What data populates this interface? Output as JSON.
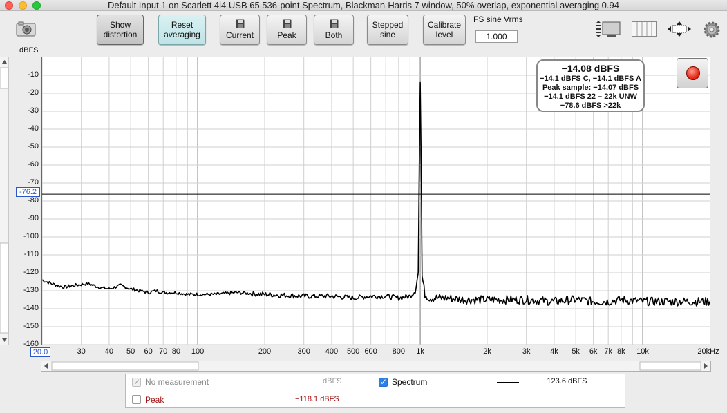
{
  "window": {
    "title": "Default Input 1 on Scarlett 4i4 USB 65,536-point Spectrum, Blackman-Harris 7 window, 50% overlap, exponential averaging 0.94"
  },
  "toolbar": {
    "show_distortion": [
      "Show",
      "distortion"
    ],
    "reset_averaging": [
      "Reset",
      "averaging"
    ],
    "current": "Current",
    "peak": "Peak",
    "both": "Both",
    "stepped_sine": [
      "Stepped",
      "sine"
    ],
    "calibrate_level": [
      "Calibrate",
      "level"
    ],
    "fs_label": "FS sine Vrms",
    "fs_value": "1.000"
  },
  "icons": {
    "camera": "camera-icon",
    "layout": "layout-icon",
    "columns": "columns-icon",
    "resize": "resize-arrows-icon",
    "gear": "gear-icon",
    "floppy": "floppy-disk-icon"
  },
  "info": {
    "line1": "−14.08 dBFS",
    "line2": "−14.1 dBFS C, −14.1 dBFS A",
    "line3": "Peak sample: −14.07 dBFS",
    "line4": "−14.1 dBFS 22 – 22k UNW",
    "line5": "−78.6 dBFS >22k"
  },
  "cursor": {
    "y_value": "-76.2",
    "x_start": "20.0"
  },
  "legend": {
    "no_measurement": "No measurement",
    "no_measurement_unit": "dBFS",
    "spectrum": "Spectrum",
    "spectrum_value": "−123.6 dBFS",
    "peak": "Peak",
    "peak_value": "−118.1 dBFS"
  },
  "colors": {
    "peak_text": "#a01818",
    "cursor_blue": "#2a56c8",
    "trace": "#000000",
    "record": "#e52c1b"
  },
  "chart_data": {
    "type": "line",
    "ylabel": "dBFS",
    "xlabel_unit": "kHz",
    "x_scale": "log",
    "xlim": [
      20,
      20000
    ],
    "ylim": [
      -160,
      0
    ],
    "y_ticks": [
      -10,
      -20,
      -30,
      -40,
      -50,
      -60,
      -70,
      -80,
      -90,
      -100,
      -110,
      -120,
      -130,
      -140,
      -150,
      -160
    ],
    "y_tick_labels": [
      "-10",
      "-20",
      "-30",
      "-40",
      "-50",
      "-60",
      "-70",
      "-80",
      "-90",
      "-100",
      "-110",
      "-120",
      "-130",
      "-140",
      "-150",
      "-160"
    ],
    "x_ticks": [
      30,
      40,
      50,
      60,
      70,
      80,
      100,
      200,
      300,
      400,
      500,
      600,
      800,
      1000,
      2000,
      3000,
      4000,
      5000,
      6000,
      7000,
      8000,
      10000,
      20000
    ],
    "x_tick_labels": [
      "30",
      "40",
      "50",
      "60",
      "70",
      "80",
      "100",
      "200",
      "300",
      "400",
      "500",
      "600",
      "800",
      "1k",
      "2k",
      "3k",
      "4k",
      "5k",
      "6k",
      "7k",
      "8k",
      "10k",
      "20kHz"
    ],
    "grid": true,
    "cursor_y": -76.2,
    "series": [
      {
        "name": "Spectrum",
        "x": [
          20,
          22,
          25,
          28,
          32,
          36,
          40,
          45,
          50,
          55,
          60,
          65,
          70,
          80,
          90,
          100,
          120,
          150,
          200,
          300,
          400,
          500,
          600,
          700,
          800,
          900,
          950,
          980,
          990,
          1000,
          1010,
          1020,
          1050,
          1100,
          1300,
          1600,
          2000,
          3000,
          4000,
          5000,
          6000,
          7000,
          8000,
          10000,
          13000,
          16000,
          20000
        ],
        "y": [
          -124,
          -126,
          -128,
          -127,
          -126,
          -128,
          -129,
          -127,
          -129,
          -130,
          -131,
          -130,
          -131,
          -131,
          -132,
          -132,
          -132,
          -131,
          -132,
          -133,
          -133,
          -134,
          -133,
          -133,
          -134,
          -133,
          -130,
          -120,
          -60,
          -14,
          -60,
          -122,
          -132,
          -134,
          -134,
          -135,
          -135,
          -135,
          -136,
          -135,
          -136,
          -136,
          -135,
          -136,
          -136,
          -136,
          -136
        ]
      }
    ]
  }
}
